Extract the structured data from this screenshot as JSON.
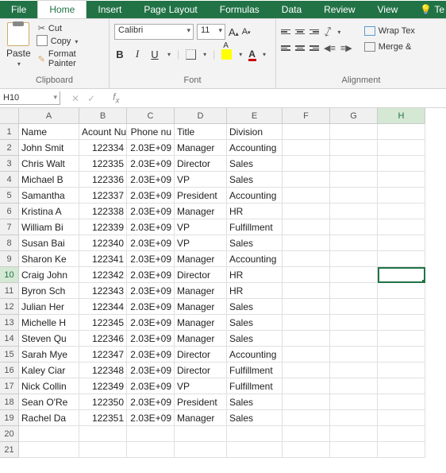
{
  "tabs": {
    "file": "File",
    "home": "Home",
    "insert": "Insert",
    "pagelayout": "Page Layout",
    "formulas": "Formulas",
    "data": "Data",
    "review": "Review",
    "view": "View",
    "te": "Te"
  },
  "ribbon": {
    "clipboard": {
      "label": "Clipboard",
      "paste": "Paste",
      "cut": "Cut",
      "copy": "Copy",
      "fpaint": "Format Painter"
    },
    "font": {
      "label": "Font",
      "name": "Calibri",
      "size": "11"
    },
    "alignment": {
      "label": "Alignment",
      "wrap": "Wrap Tex",
      "merge": "Merge &"
    }
  },
  "namebox": "H10",
  "cols": [
    "A",
    "B",
    "C",
    "D",
    "E",
    "F",
    "G",
    "H"
  ],
  "headers": {
    "A": "Name",
    "B": "Acount Nu",
    "C": "Phone nu",
    "D": "Title",
    "E": "Division"
  },
  "rows": [
    {
      "n": "2",
      "A": "John Smit",
      "B": "122334",
      "C": "2.03E+09",
      "D": "Manager",
      "E": "Accounting"
    },
    {
      "n": "3",
      "A": "Chris Walt",
      "B": "122335",
      "C": "2.03E+09",
      "D": "Director",
      "E": "Sales"
    },
    {
      "n": "4",
      "A": "Michael B",
      "B": "122336",
      "C": "2.03E+09",
      "D": "VP",
      "E": "Sales"
    },
    {
      "n": "5",
      "A": "Samantha",
      "B": "122337",
      "C": "2.03E+09",
      "D": "President",
      "E": "Accounting"
    },
    {
      "n": "6",
      "A": "Kristina A",
      "B": "122338",
      "C": "2.03E+09",
      "D": "Manager",
      "E": "HR"
    },
    {
      "n": "7",
      "A": "William Bi",
      "B": "122339",
      "C": "2.03E+09",
      "D": "VP",
      "E": "Fulfillment"
    },
    {
      "n": "8",
      "A": "Susan Bai",
      "B": "122340",
      "C": "2.03E+09",
      "D": "VP",
      "E": "Sales"
    },
    {
      "n": "9",
      "A": "Sharon Ke",
      "B": "122341",
      "C": "2.03E+09",
      "D": "Manager",
      "E": "Accounting"
    },
    {
      "n": "10",
      "A": "Craig John",
      "B": "122342",
      "C": "2.03E+09",
      "D": "Director",
      "E": "HR"
    },
    {
      "n": "11",
      "A": "Byron Sch",
      "B": "122343",
      "C": "2.03E+09",
      "D": "Manager",
      "E": "HR"
    },
    {
      "n": "12",
      "A": "Julian Her",
      "B": "122344",
      "C": "2.03E+09",
      "D": "Manager",
      "E": "Sales"
    },
    {
      "n": "13",
      "A": "Michelle H",
      "B": "122345",
      "C": "2.03E+09",
      "D": "Manager",
      "E": "Sales"
    },
    {
      "n": "14",
      "A": "Steven Qu",
      "B": "122346",
      "C": "2.03E+09",
      "D": "Manager",
      "E": "Sales"
    },
    {
      "n": "15",
      "A": "Sarah Mye",
      "B": "122347",
      "C": "2.03E+09",
      "D": "Director",
      "E": "Accounting"
    },
    {
      "n": "16",
      "A": "Kaley Ciar",
      "B": "122348",
      "C": "2.03E+09",
      "D": "Director",
      "E": "Fulfillment"
    },
    {
      "n": "17",
      "A": "Nick Collin",
      "B": "122349",
      "C": "2.03E+09",
      "D": "VP",
      "E": "Fulfillment"
    },
    {
      "n": "18",
      "A": "Sean O'Re",
      "B": "122350",
      "C": "2.03E+09",
      "D": "President",
      "E": "Sales"
    },
    {
      "n": "19",
      "A": "Rachel Da",
      "B": "122351",
      "C": "2.03E+09",
      "D": "Manager",
      "E": "Sales"
    }
  ],
  "emptyrows": [
    "20",
    "21"
  ],
  "selected": {
    "row": "10",
    "col": "H"
  }
}
